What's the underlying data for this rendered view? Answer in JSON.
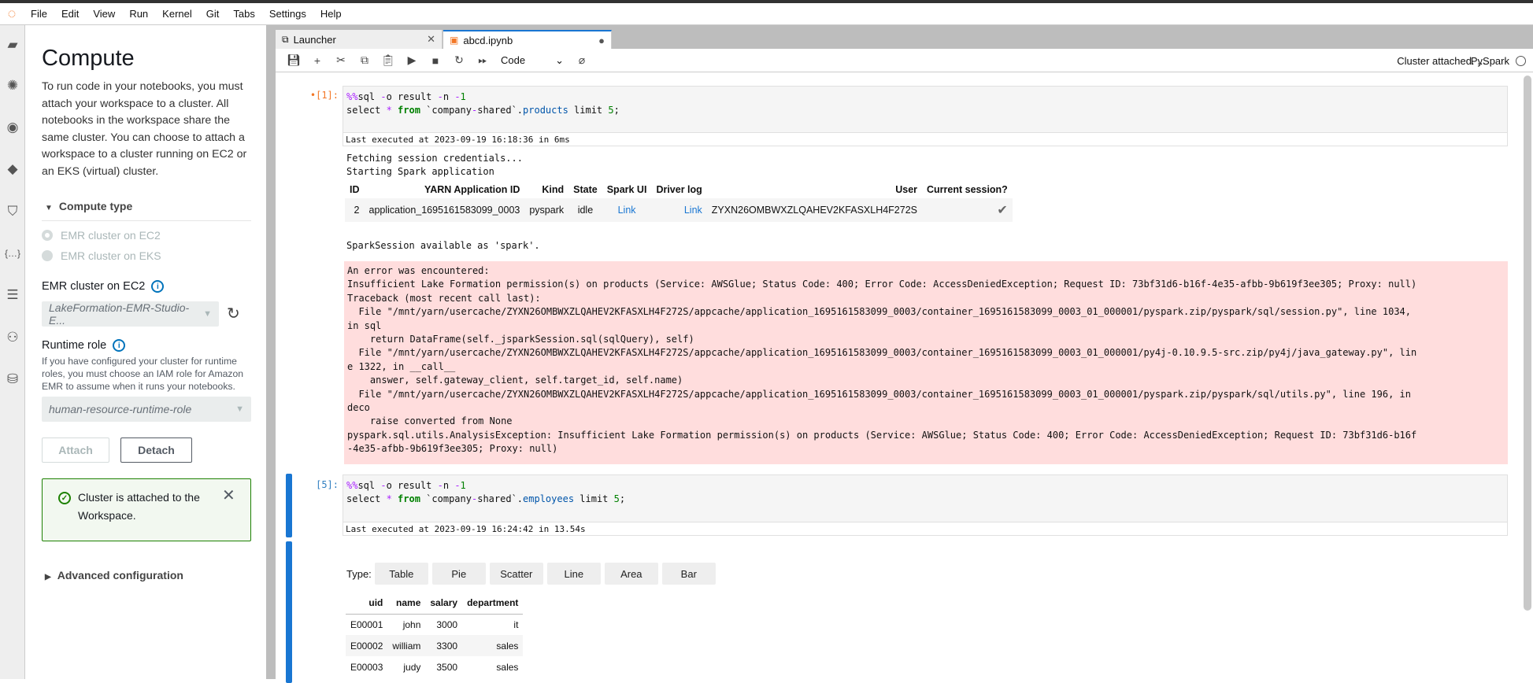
{
  "menubar": {
    "items": [
      "File",
      "Edit",
      "View",
      "Run",
      "Kernel",
      "Git",
      "Tabs",
      "Settings",
      "Help"
    ]
  },
  "sidebar_icons": [
    "folder-icon",
    "git-extension-icon",
    "running-icon",
    "git-icon",
    "extension-icon",
    "variables-icon",
    "toc-icon",
    "compute-icon",
    "database-icon"
  ],
  "panel": {
    "title": "Compute",
    "description": "To run code in your notebooks, you must attach your workspace to a cluster. All notebooks in the workspace share the same cluster. You can choose to attach a workspace to a cluster running on EC2 or an EKS (virtual) cluster.",
    "compute_type_label": "Compute type",
    "radio_options": [
      "EMR cluster on EC2",
      "EMR cluster on EKS"
    ],
    "cluster_label": "EMR cluster on EC2",
    "cluster_value": "LakeFormation-EMR-Studio-E...",
    "runtime_label": "Runtime role",
    "runtime_desc": "If you have configured your cluster for runtime roles, you must choose an IAM role for Amazon EMR to assume when it runs your notebooks.",
    "runtime_value": "human-resource-runtime-role",
    "attach": "Attach",
    "detach": "Detach",
    "alert": "Cluster is attached to the Workspace.",
    "advanced": "Advanced configuration",
    "accent": "#0073bb",
    "success": "#1d8102"
  },
  "tabs": [
    {
      "label": "Launcher"
    },
    {
      "label": "abcd.ipynb"
    }
  ],
  "toolbar": {
    "cell_type": "Code",
    "kernel_status": "Cluster attached. ...",
    "kernel_name": "PySpark"
  },
  "cell1": {
    "prompt": "[1]:",
    "line1": [
      "%%",
      "sql ",
      "-",
      "o result ",
      "-",
      "n ",
      "-",
      "1"
    ],
    "line2": [
      "select ",
      "*",
      " ",
      "from",
      " `company",
      "-",
      "shared`.",
      "products",
      " limit ",
      "5",
      ";"
    ],
    "last_exec": "Last executed at 2023-09-19 16:18:36 in 6ms",
    "out1": "Fetching session credentials...",
    "out2": "Starting Spark application",
    "session_headers": [
      "ID",
      "YARN Application ID",
      "Kind",
      "State",
      "Spark UI",
      "Driver log",
      "User",
      "Current session?"
    ],
    "session_row": [
      "2",
      "application_1695161583099_0003",
      "pyspark",
      "idle",
      "Link",
      "Link",
      "ZYXN26OMBWXZLQAHEV2KFASXLH4F272S",
      "✔"
    ],
    "spark_avail": "SparkSession available as 'spark'.",
    "error": "An error was encountered:\nInsufficient Lake Formation permission(s) on products (Service: AWSGlue; Status Code: 400; Error Code: AccessDeniedException; Request ID: 73bf31d6-b16f-4e35-afbb-9b619f3ee305; Proxy: null)\nTraceback (most recent call last):\n  File \"/mnt/yarn/usercache/ZYXN26OMBWXZLQAHEV2KFASXLH4F272S/appcache/application_1695161583099_0003/container_1695161583099_0003_01_000001/pyspark.zip/pyspark/sql/session.py\", line 1034,\nin sql\n    return DataFrame(self._jsparkSession.sql(sqlQuery), self)\n  File \"/mnt/yarn/usercache/ZYXN26OMBWXZLQAHEV2KFASXLH4F272S/appcache/application_1695161583099_0003/container_1695161583099_0003_01_000001/py4j-0.10.9.5-src.zip/py4j/java_gateway.py\", lin\ne 1322, in __call__\n    answer, self.gateway_client, self.target_id, self.name)\n  File \"/mnt/yarn/usercache/ZYXN26OMBWXZLQAHEV2KFASXLH4F272S/appcache/application_1695161583099_0003/container_1695161583099_0003_01_000001/pyspark.zip/pyspark/sql/utils.py\", line 196, in\ndeco\n    raise converted from None\npyspark.sql.utils.AnalysisException: Insufficient Lake Formation permission(s) on products (Service: AWSGlue; Status Code: 400; Error Code: AccessDeniedException; Request ID: 73bf31d6-b16f\n-4e35-afbb-9b619f3ee305; Proxy: null)"
  },
  "cell5": {
    "prompt": "[5]:",
    "line1": [
      "%%",
      "sql ",
      "-",
      "o result ",
      "-",
      "n ",
      "-",
      "1"
    ],
    "line2": [
      "select ",
      "*",
      " ",
      "from",
      " `company",
      "-",
      "shared`.",
      "employees",
      " limit ",
      "5",
      ";"
    ],
    "last_exec": "Last executed at 2023-09-19 16:24:42 in 13.54s",
    "type_label": "Type:",
    "type_buttons": [
      "Table",
      "Pie",
      "Scatter",
      "Line",
      "Area",
      "Bar"
    ],
    "table_headers": [
      "uid",
      "name",
      "salary",
      "department"
    ],
    "table_rows": [
      [
        "E00001",
        "john",
        "3000",
        "it"
      ],
      [
        "E00002",
        "william",
        "3300",
        "sales"
      ],
      [
        "E00003",
        "judy",
        "3500",
        "sales"
      ]
    ]
  }
}
